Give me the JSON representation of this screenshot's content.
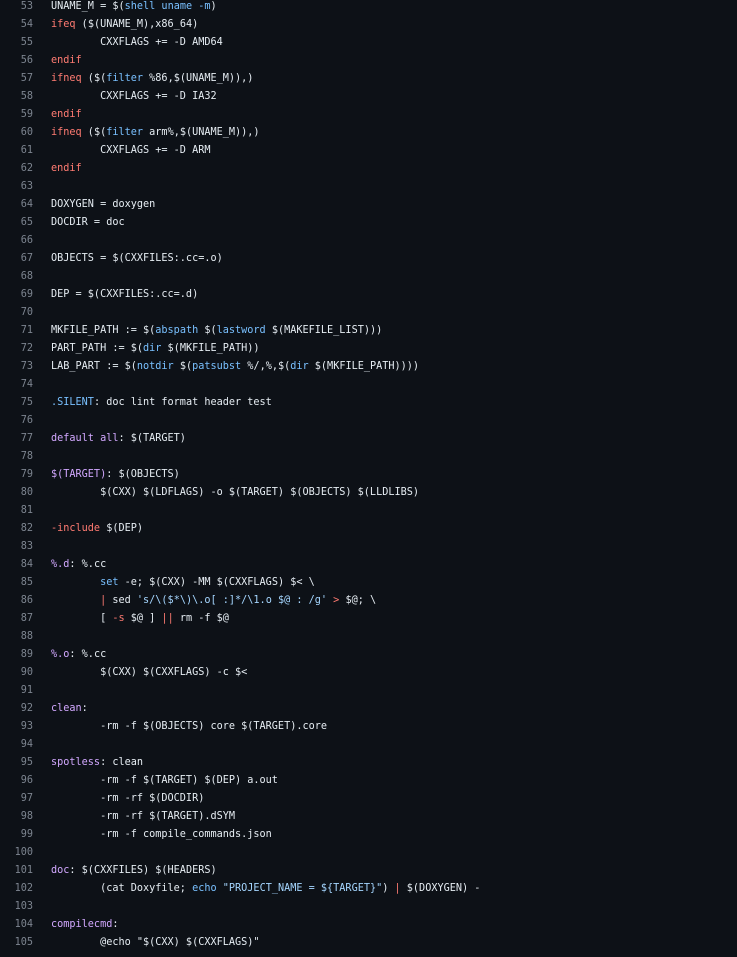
{
  "colors": {
    "background": "#0d1117",
    "line_number": "#7d8590",
    "text": "#e6edf3",
    "keyword": "#ff7b72",
    "function": "#d2a8ff",
    "variable": "#79c0ff",
    "string": "#a5d6ff"
  },
  "lines": [
    {
      "n": "53",
      "tokens": [
        [
          "pl",
          "UNAME_M = "
        ],
        [
          "pl",
          "$("
        ],
        [
          "var",
          "shell"
        ],
        [
          "var",
          " uname -m"
        ],
        [
          "pl",
          ")"
        ]
      ]
    },
    {
      "n": "54",
      "tokens": [
        [
          "kw",
          "ifeq"
        ],
        [
          "pl",
          " ($(UNAME_M),x86_64)"
        ]
      ]
    },
    {
      "n": "55",
      "tokens": [
        [
          "pl",
          "        CXXFLAGS += -D AMD64"
        ]
      ]
    },
    {
      "n": "56",
      "tokens": [
        [
          "kw",
          "endif"
        ]
      ]
    },
    {
      "n": "57",
      "tokens": [
        [
          "kw",
          "ifneq"
        ],
        [
          "pl",
          " ($("
        ],
        [
          "var",
          "filter"
        ],
        [
          "pl",
          " %86,$(UNAME_M)),)"
        ]
      ]
    },
    {
      "n": "58",
      "tokens": [
        [
          "pl",
          "        CXXFLAGS += -D IA32"
        ]
      ]
    },
    {
      "n": "59",
      "tokens": [
        [
          "kw",
          "endif"
        ]
      ]
    },
    {
      "n": "60",
      "tokens": [
        [
          "kw",
          "ifneq"
        ],
        [
          "pl",
          " ($("
        ],
        [
          "var",
          "filter"
        ],
        [
          "pl",
          " arm%,$(UNAME_M)),)"
        ]
      ]
    },
    {
      "n": "61",
      "tokens": [
        [
          "pl",
          "        CXXFLAGS += -D ARM"
        ]
      ]
    },
    {
      "n": "62",
      "tokens": [
        [
          "kw",
          "endif"
        ]
      ]
    },
    {
      "n": "63",
      "tokens": []
    },
    {
      "n": "64",
      "tokens": [
        [
          "pl",
          "DOXYGEN = doxygen"
        ]
      ]
    },
    {
      "n": "65",
      "tokens": [
        [
          "pl",
          "DOCDIR = doc"
        ]
      ]
    },
    {
      "n": "66",
      "tokens": []
    },
    {
      "n": "67",
      "tokens": [
        [
          "pl",
          "OBJECTS = $(CXXFILES:.cc=.o)"
        ]
      ]
    },
    {
      "n": "68",
      "tokens": []
    },
    {
      "n": "69",
      "tokens": [
        [
          "pl",
          "DEP = $(CXXFILES:.cc=.d)"
        ]
      ]
    },
    {
      "n": "70",
      "tokens": []
    },
    {
      "n": "71",
      "tokens": [
        [
          "pl",
          "MKFILE_PATH := $("
        ],
        [
          "var",
          "abspath"
        ],
        [
          "pl",
          " $("
        ],
        [
          "var",
          "lastword"
        ],
        [
          "pl",
          " $(MAKEFILE_LIST)))"
        ]
      ]
    },
    {
      "n": "72",
      "tokens": [
        [
          "pl",
          "PART_PATH := $("
        ],
        [
          "var",
          "dir"
        ],
        [
          "pl",
          " $(MKFILE_PATH))"
        ]
      ]
    },
    {
      "n": "73",
      "tokens": [
        [
          "pl",
          "LAB_PART := $("
        ],
        [
          "var",
          "notdir"
        ],
        [
          "pl",
          " $("
        ],
        [
          "var",
          "patsubst"
        ],
        [
          "pl",
          " %/,%,$("
        ],
        [
          "var",
          "dir"
        ],
        [
          "pl",
          " $(MKFILE_PATH))))"
        ]
      ]
    },
    {
      "n": "74",
      "tokens": []
    },
    {
      "n": "75",
      "tokens": [
        [
          "var",
          ".SILENT"
        ],
        [
          "pl",
          ": doc lint format header test"
        ]
      ]
    },
    {
      "n": "76",
      "tokens": []
    },
    {
      "n": "77",
      "tokens": [
        [
          "fn",
          "default all"
        ],
        [
          "pl",
          ": $(TARGET)"
        ]
      ]
    },
    {
      "n": "78",
      "tokens": []
    },
    {
      "n": "79",
      "tokens": [
        [
          "fn",
          "$(TARGET)"
        ],
        [
          "pl",
          ": $(OBJECTS)"
        ]
      ]
    },
    {
      "n": "80",
      "tokens": [
        [
          "pl",
          "        $(CXX) $(LDFLAGS) -o $(TARGET) $(OBJECTS) $(LLDLIBS)"
        ]
      ]
    },
    {
      "n": "81",
      "tokens": []
    },
    {
      "n": "82",
      "tokens": [
        [
          "kw",
          "-include"
        ],
        [
          "pl",
          " $(DEP)"
        ]
      ]
    },
    {
      "n": "83",
      "tokens": []
    },
    {
      "n": "84",
      "tokens": [
        [
          "fn",
          "%.d"
        ],
        [
          "pl",
          ": %.cc"
        ]
      ]
    },
    {
      "n": "85",
      "tokens": [
        [
          "pl",
          "        "
        ],
        [
          "var",
          "set"
        ],
        [
          "pl",
          " -e; $(CXX) -MM $(CXXFLAGS) $< \\"
        ]
      ]
    },
    {
      "n": "86",
      "tokens": [
        [
          "pl",
          "        "
        ],
        [
          "kw",
          "|"
        ],
        [
          "pl",
          " sed "
        ],
        [
          "str",
          "'s/\\($*\\)\\.o[ :]*/\\1.o $@ : /g'"
        ],
        [
          "pl",
          " "
        ],
        [
          "kw",
          ">"
        ],
        [
          "pl",
          " $@; \\"
        ]
      ]
    },
    {
      "n": "87",
      "tokens": [
        [
          "pl",
          "        [ "
        ],
        [
          "kw",
          "-s"
        ],
        [
          "pl",
          " $@ ] "
        ],
        [
          "kw",
          "||"
        ],
        [
          "pl",
          " rm -f $@"
        ]
      ]
    },
    {
      "n": "88",
      "tokens": []
    },
    {
      "n": "89",
      "tokens": [
        [
          "fn",
          "%.o"
        ],
        [
          "pl",
          ": %.cc"
        ]
      ]
    },
    {
      "n": "90",
      "tokens": [
        [
          "pl",
          "        $(CXX) $(CXXFLAGS) -c $<"
        ]
      ]
    },
    {
      "n": "91",
      "tokens": []
    },
    {
      "n": "92",
      "tokens": [
        [
          "fn",
          "clean"
        ],
        [
          "pl",
          ":"
        ]
      ]
    },
    {
      "n": "93",
      "tokens": [
        [
          "pl",
          "        -rm -f $(OBJECTS) core $(TARGET).core"
        ]
      ]
    },
    {
      "n": "94",
      "tokens": []
    },
    {
      "n": "95",
      "tokens": [
        [
          "fn",
          "spotless"
        ],
        [
          "pl",
          ": clean"
        ]
      ]
    },
    {
      "n": "96",
      "tokens": [
        [
          "pl",
          "        -rm -f $(TARGET) $(DEP) a.out"
        ]
      ]
    },
    {
      "n": "97",
      "tokens": [
        [
          "pl",
          "        -rm -rf $(DOCDIR)"
        ]
      ]
    },
    {
      "n": "98",
      "tokens": [
        [
          "pl",
          "        -rm -rf $(TARGET).dSYM"
        ]
      ]
    },
    {
      "n": "99",
      "tokens": [
        [
          "pl",
          "        -rm -f compile_commands.json"
        ]
      ]
    },
    {
      "n": "100",
      "tokens": []
    },
    {
      "n": "101",
      "tokens": [
        [
          "fn",
          "doc"
        ],
        [
          "pl",
          ": $(CXXFILES) $(HEADERS)"
        ]
      ]
    },
    {
      "n": "102",
      "tokens": [
        [
          "pl",
          "        (cat Doxyfile; "
        ],
        [
          "var",
          "echo"
        ],
        [
          "pl",
          " "
        ],
        [
          "str",
          "\"PROJECT_NAME = ${TARGET}\""
        ],
        [
          "pl",
          ") "
        ],
        [
          "kw",
          "|"
        ],
        [
          "pl",
          " $(DOXYGEN) -"
        ]
      ]
    },
    {
      "n": "103",
      "tokens": []
    },
    {
      "n": "104",
      "tokens": [
        [
          "fn",
          "compilecmd"
        ],
        [
          "pl",
          ":"
        ]
      ]
    },
    {
      "n": "105",
      "tokens": [
        [
          "pl",
          "        @echo \"$(CXX) $(CXXFLAGS)\""
        ]
      ]
    }
  ]
}
